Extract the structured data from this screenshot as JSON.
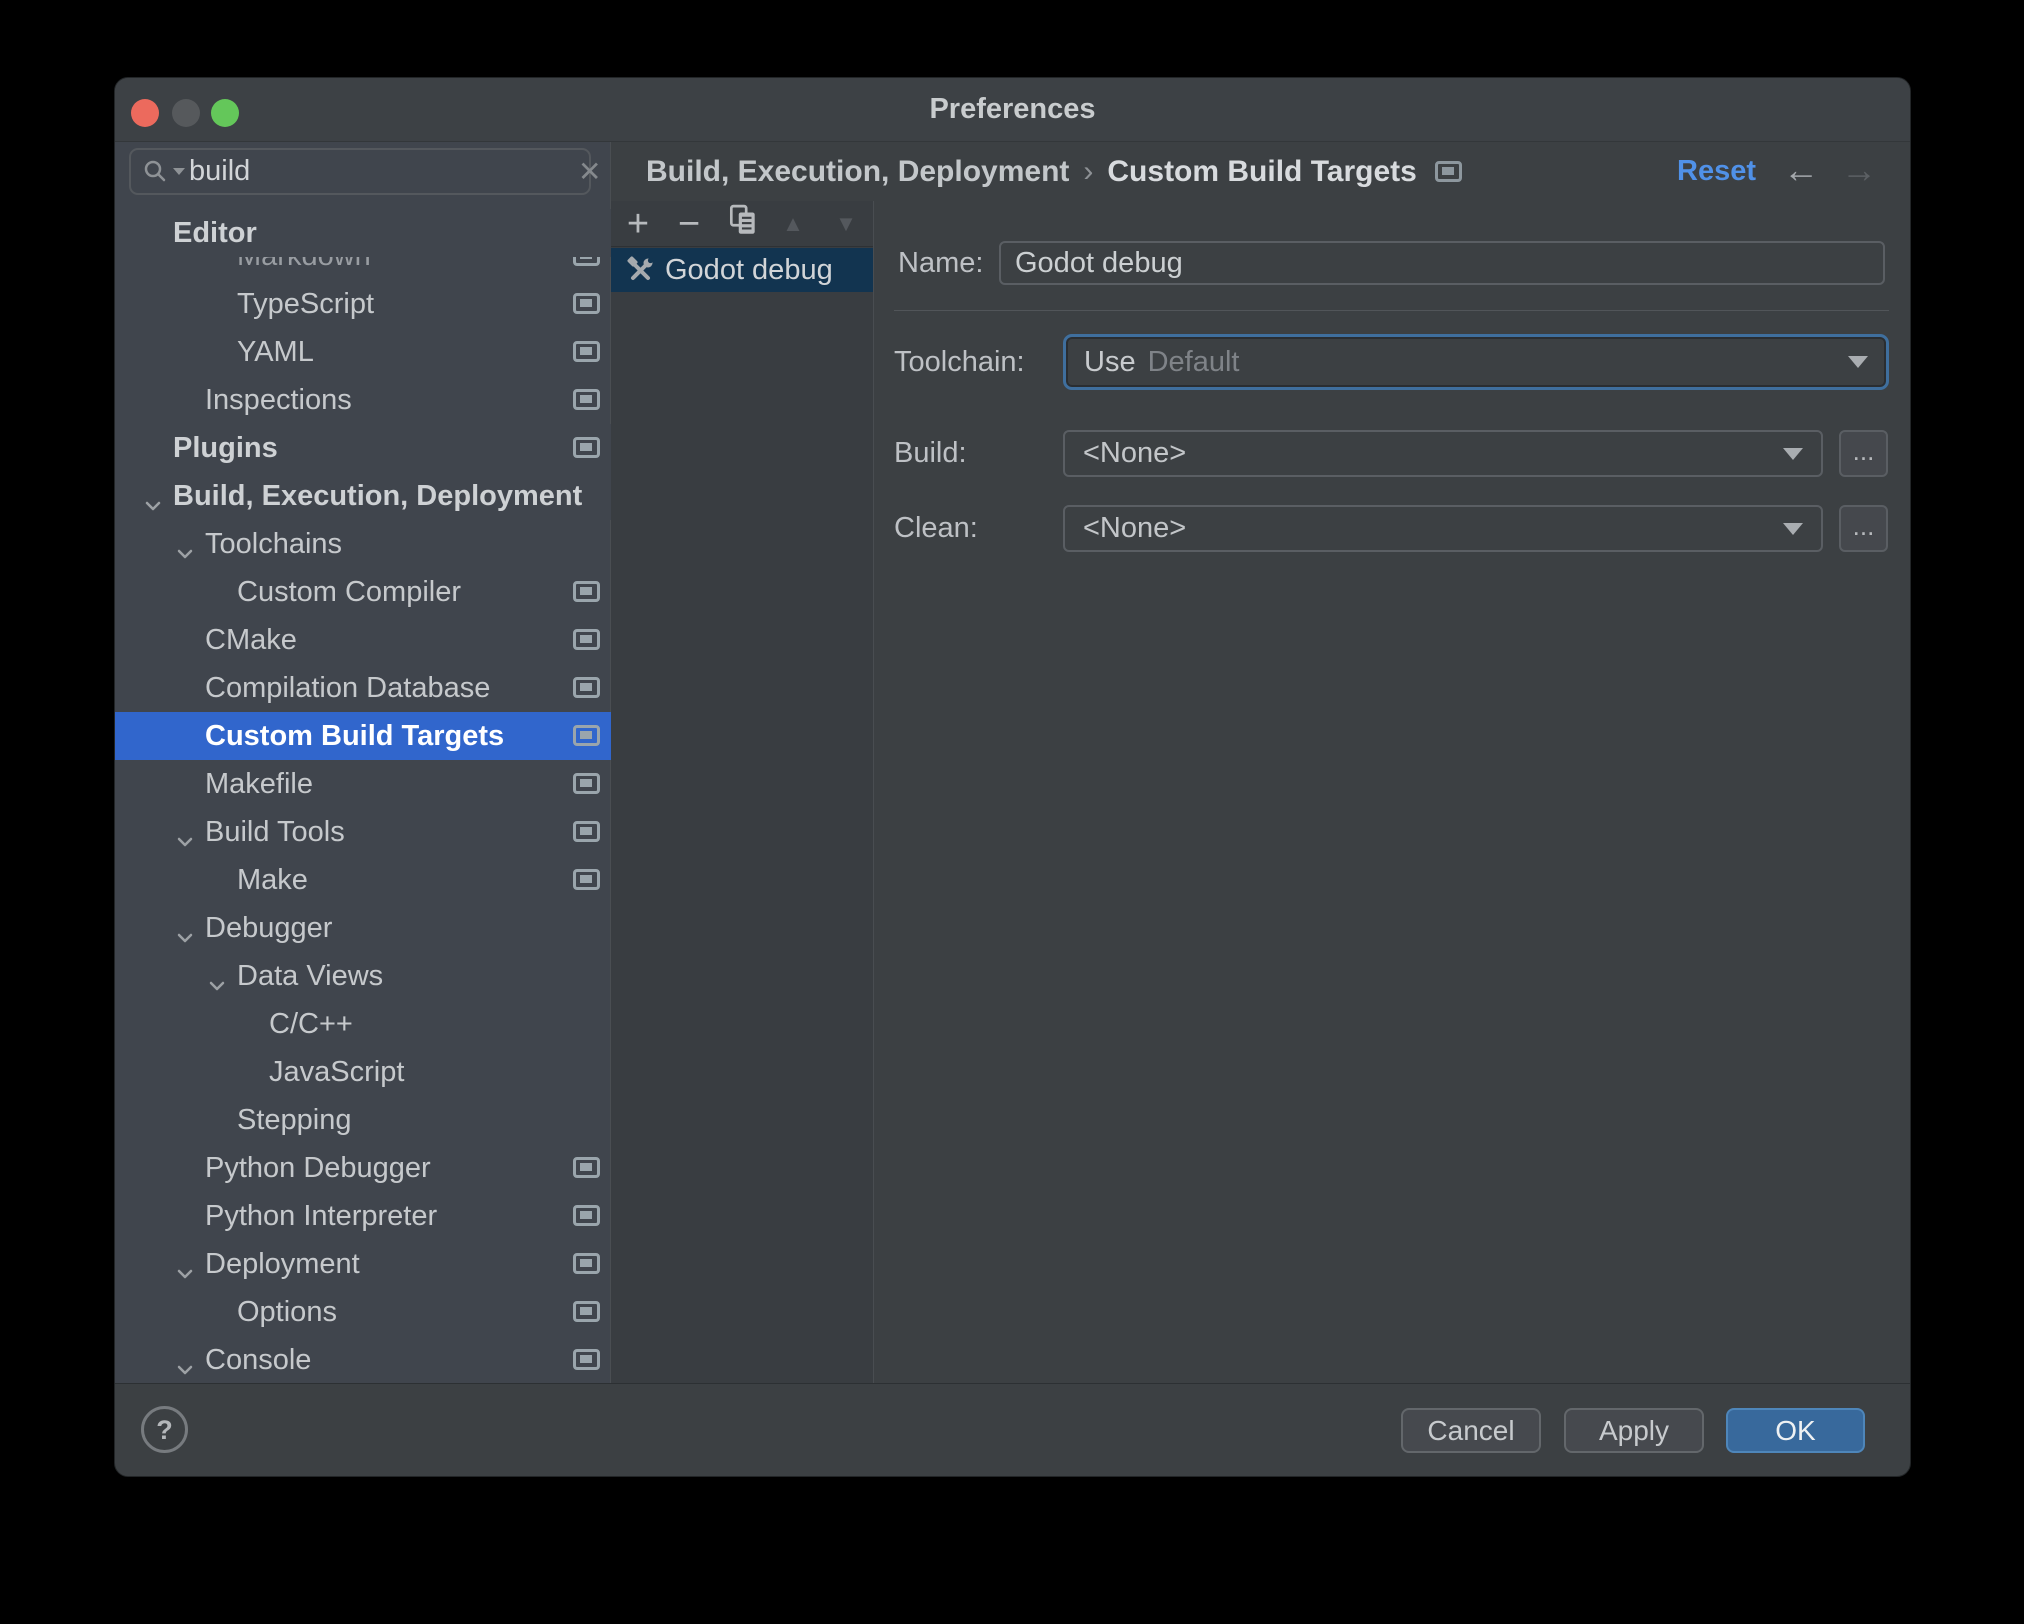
{
  "window": {
    "title": "Preferences"
  },
  "sidebar": {
    "search": {
      "value": "build"
    },
    "tree": [
      {
        "label": "Editor",
        "level": 1,
        "bold": true
      },
      {
        "label": "Markdown",
        "level": 3,
        "icon": true,
        "clipped": true
      },
      {
        "label": "TypeScript",
        "level": 3,
        "icon": true
      },
      {
        "label": "YAML",
        "level": 3,
        "icon": true
      },
      {
        "label": "Inspections",
        "level": 2,
        "icon": true
      },
      {
        "label": "Plugins",
        "level": 1,
        "bold": true,
        "icon": true
      },
      {
        "label": "Build, Execution, Deployment",
        "level": 1,
        "bold": true,
        "chevron": true
      },
      {
        "label": "Toolchains",
        "level": 2,
        "chevron": true
      },
      {
        "label": "Custom Compiler",
        "level": 3,
        "icon": true
      },
      {
        "label": "CMake",
        "level": 2,
        "icon": true
      },
      {
        "label": "Compilation Database",
        "level": 2,
        "icon": true
      },
      {
        "label": "Custom Build Targets",
        "level": 2,
        "icon": true,
        "selected": true
      },
      {
        "label": "Makefile",
        "level": 2,
        "icon": true
      },
      {
        "label": "Build Tools",
        "level": 2,
        "chevron": true,
        "icon": true
      },
      {
        "label": "Make",
        "level": 3,
        "icon": true
      },
      {
        "label": "Debugger",
        "level": 2,
        "chevron": true
      },
      {
        "label": "Data Views",
        "level": 3,
        "chevron": true
      },
      {
        "label": "C/C++",
        "level": 4
      },
      {
        "label": "JavaScript",
        "level": 4
      },
      {
        "label": "Stepping",
        "level": 3
      },
      {
        "label": "Python Debugger",
        "level": 2,
        "icon": true
      },
      {
        "label": "Python Interpreter",
        "level": 2,
        "icon": true
      },
      {
        "label": "Deployment",
        "level": 2,
        "chevron": true,
        "icon": true
      },
      {
        "label": "Options",
        "level": 3,
        "icon": true
      },
      {
        "label": "Console",
        "level": 2,
        "chevron": true,
        "icon": true
      }
    ]
  },
  "header": {
    "breadcrumb": [
      {
        "label": "Build, Execution, Deployment"
      },
      {
        "label": "Custom Build Targets"
      }
    ],
    "separator": "›",
    "reset_label": "Reset",
    "back_arrow": "←",
    "forward_arrow": "→"
  },
  "list_panel": {
    "toolbar": [
      {
        "name": "add",
        "glyph": "+",
        "enabled": true
      },
      {
        "name": "remove",
        "glyph": "−",
        "enabled": true
      },
      {
        "name": "duplicate",
        "glyph": "svg",
        "enabled": true
      },
      {
        "name": "move-up",
        "glyph": "▲",
        "enabled": false
      },
      {
        "name": "move-down",
        "glyph": "▼",
        "enabled": false
      }
    ],
    "items": [
      {
        "label": "Godot debug",
        "selected": true
      }
    ]
  },
  "form": {
    "name": {
      "label": "Name:",
      "value": "Godot debug"
    },
    "toolchain": {
      "label": "Toolchain:",
      "prefix": "Use",
      "value": "Default"
    },
    "build": {
      "label": "Build:",
      "value": "<None>",
      "browse": "..."
    },
    "clean": {
      "label": "Clean:",
      "value": "<None>",
      "browse": "..."
    }
  },
  "footer": {
    "help": "?",
    "cancel": "Cancel",
    "apply": "Apply",
    "ok": "OK"
  },
  "colors": {
    "tree_selection": "#3166cc",
    "list_selection": "#123450",
    "accent_link": "#5091e8",
    "ok_button": "#38699c",
    "focus_ring": "#3f6f9e"
  }
}
